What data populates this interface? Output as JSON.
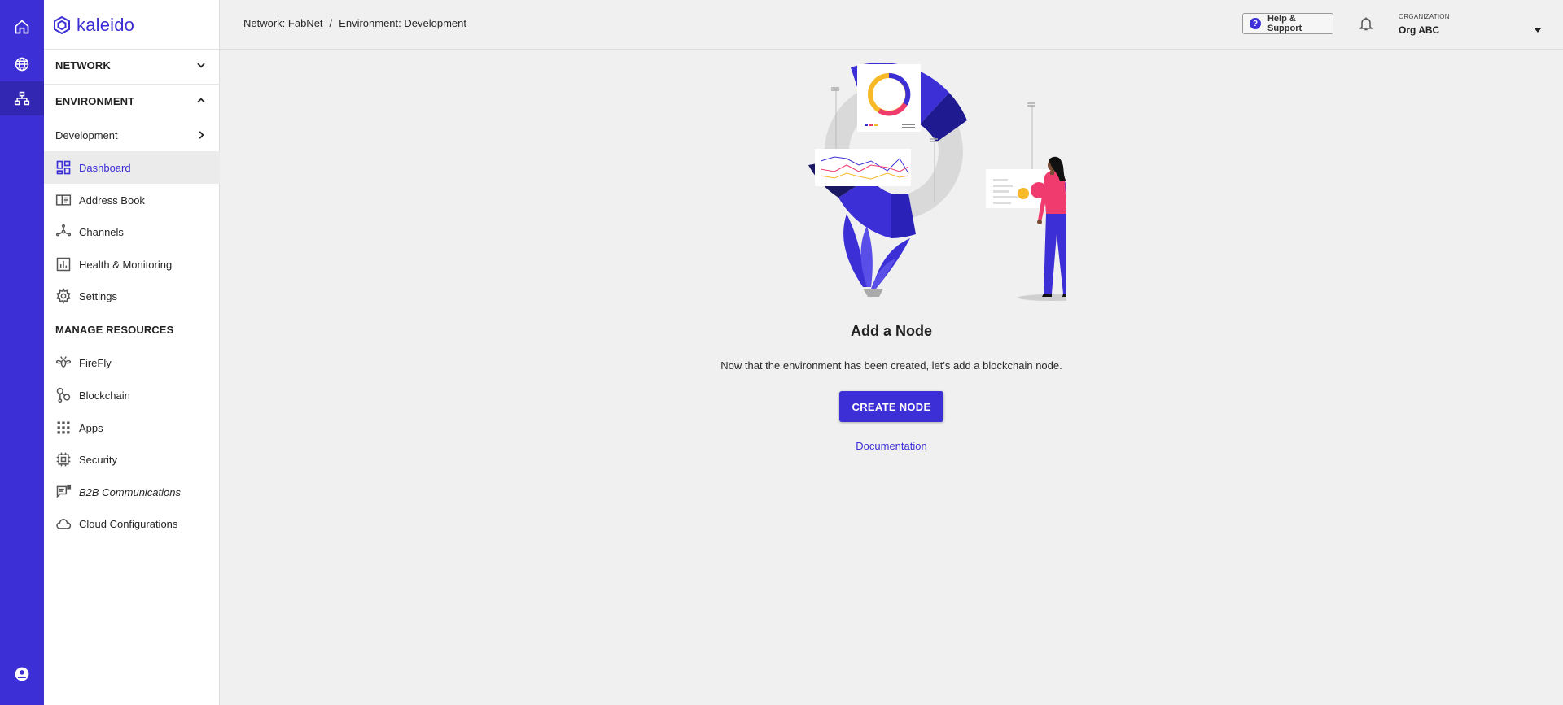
{
  "brand": {
    "name": "kaleido"
  },
  "rail": {
    "items": [
      {
        "icon": "home-icon"
      },
      {
        "icon": "globe-icon"
      },
      {
        "icon": "network-icon"
      }
    ],
    "account_icon": "account-circle-icon"
  },
  "sidebar": {
    "network_section": "NETWORK",
    "environment_section": "ENVIRONMENT",
    "environment_name": "Development",
    "env_items": [
      {
        "label": "Dashboard",
        "icon": "dashboard-icon"
      },
      {
        "label": "Address Book",
        "icon": "address-book-icon"
      },
      {
        "label": "Channels",
        "icon": "channels-icon"
      },
      {
        "label": "Health & Monitoring",
        "icon": "health-monitoring-icon"
      },
      {
        "label": "Settings",
        "icon": "gear-icon"
      }
    ],
    "manage_section": "MANAGE RESOURCES",
    "resource_items": [
      {
        "label": "FireFly",
        "icon": "firefly-icon"
      },
      {
        "label": "Blockchain",
        "icon": "blockchain-icon"
      },
      {
        "label": "Apps",
        "icon": "apps-grid-icon"
      },
      {
        "label": "Security",
        "icon": "security-chip-icon"
      },
      {
        "label": "B2B Communications",
        "icon": "b2b-chat-icon"
      },
      {
        "label": "Cloud Configurations",
        "icon": "cloud-icon"
      }
    ]
  },
  "header": {
    "breadcrumb": {
      "network": "Network: FabNet",
      "separator": "/",
      "environment": "Environment: Development"
    },
    "help_label": "Help & Support",
    "org_caption": "ORGANIZATION",
    "org_name": "Org ABC"
  },
  "main": {
    "title": "Add a Node",
    "subtitle": "Now that the environment has been created, let's add a blockchain node.",
    "create_button": "CREATE NODE",
    "doc_link": "Documentation"
  },
  "colors": {
    "brand": "#3c2fd6",
    "dark_accent": "#1a1863",
    "yellow": "#f7b928",
    "pink": "#ef3b6e"
  }
}
